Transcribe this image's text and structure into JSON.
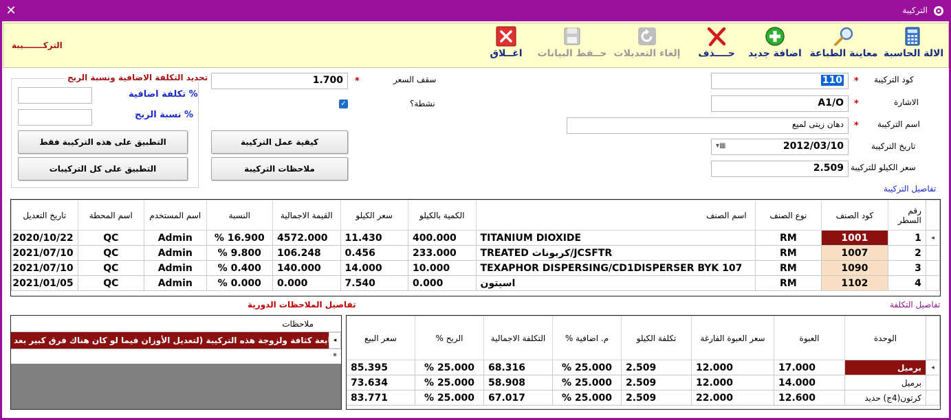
{
  "window": {
    "title": "التركيبة",
    "close_glyph": "✕"
  },
  "toolbar": {
    "calculator": "الالة الحاسبة",
    "print_preview": "معاينة الطباعة",
    "add_new": "اضافة جديد",
    "delete": "حــــذف",
    "cancel_edits": "إلغاء التعديلات",
    "save_data": "حــفظ البيانات",
    "close": "اغــلاق",
    "form_title": "التركـــــــيبة"
  },
  "form": {
    "code_label": "كود التركيبة",
    "code_value": "110",
    "sign_label": "الاشارة",
    "sign_value": "A1/O",
    "name_label": "اسم التركيبة",
    "name_value": "دهان زيتى لميع",
    "date_label": "تاريخ التركيبة",
    "date_value": "2012/03/10",
    "kilo_price_label": "سعر الكيلو للتركيبة",
    "kilo_price_value": "2.509",
    "ceiling_label": "سقف السعر",
    "ceiling_value": "1.700",
    "active_label": "نشطة؟",
    "required_mark": "*"
  },
  "cost_group": {
    "title": "تحديد التكلفة الاضافية ونسبة الربح",
    "extra_cost_label": "تكلفة اضافية %",
    "profit_label": "نسبة الربح %",
    "apply_this": "التطبيق على هذه التركيبة فقط",
    "apply_all": "التطبيق على كل التركيبات"
  },
  "buttons": {
    "how_to": "كيفية عمل التركيبة",
    "notes": "ملاحظات التركيبة"
  },
  "details": {
    "section_title": "تفاصيل التركيبة",
    "headers": [
      "رقم السطر",
      "كود الصنف",
      "نوع الصنف",
      "اسم الصنف",
      "الكمية بالكيلو",
      "سعر الكيلو",
      "القيمة الاجمالية",
      "النسبة",
      "اسم المستخدم",
      "اسم المحطة",
      "تاريخ التعديل"
    ],
    "rows": [
      [
        "1",
        "1001",
        "RM",
        "TITANIUM DIOXIDE",
        "400.000",
        "11.430",
        "4572.000",
        "16.900 %",
        "Admin",
        "QC",
        "2020/10/22"
      ],
      [
        "2",
        "1007",
        "RM",
        "JCSFTR/كربونات TREATED",
        "233.000",
        "0.456",
        "106.248",
        "9.800 %",
        "Admin",
        "QC",
        "2021/07/10"
      ],
      [
        "3",
        "1090",
        "RM",
        "TEXAPHOR DISPERSING/CD1DISPERSER BYK 107",
        "10.000",
        "14.000",
        "140.000",
        "0.400 %",
        "Admin",
        "QC",
        "2021/07/10"
      ],
      [
        "4",
        "1102",
        "RM",
        "اسيتون",
        "0.000",
        "7.540",
        "0.000",
        "0.000 %",
        "Admin",
        "QC",
        "2021/01/05"
      ]
    ]
  },
  "cost_details": {
    "section_title": "تفاصيل التكلفة",
    "headers": [
      "الوحدة",
      "العبوة",
      "سعر العبوة الفارغة",
      "تكلفة الكيلو",
      "م. اضافية %",
      "التكلفة الاجمالية",
      "الربح %",
      "سعر البيع"
    ],
    "rows": [
      [
        "برميل",
        "17.000",
        "12.000",
        "2.509",
        "25.000 %",
        "68.316",
        "25.000 %",
        "85.395"
      ],
      [
        "برميل",
        "14.000",
        "12.000",
        "2.509",
        "25.000 %",
        "58.908",
        "25.000 %",
        "73.634"
      ],
      [
        "كرتون(4ج) حديد",
        "12.600",
        "22.000",
        "2.509",
        "25.000 %",
        "67.017",
        "25.000 %",
        "83.771"
      ]
    ]
  },
  "notes_panel": {
    "section_title": "تفاصيل الملاحظات الدورية",
    "header": "ملاحظات",
    "row": "متابعة كثافة ولزوجة هذه التركيبة (لتعديل الأوزان فيما لو كان هناك فرق كبير بعد...",
    "new_row_mark": "*"
  },
  "colors": {
    "title_bar": "#99109a",
    "toolbar_bg": "#ffffcc",
    "selected_cell": "#8b1010",
    "code_cell": "#f9e0c4"
  }
}
